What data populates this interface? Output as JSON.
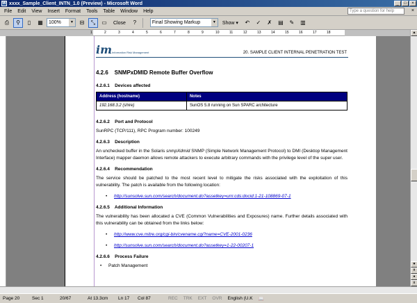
{
  "window": {
    "title": "xxxx_Sample_Client_INTN_1.0 (Preview) - Microsoft Word"
  },
  "menu": {
    "items": [
      "File",
      "Edit",
      "View",
      "Insert",
      "Format",
      "Tools",
      "Table",
      "Window",
      "Help"
    ],
    "help_placeholder": "Type a question for help"
  },
  "toolbar": {
    "zoom": "100%",
    "close_label": "Close",
    "markup_view": "Final Showing Markup",
    "show_label": "Show"
  },
  "ruler": {
    "marks": [
      "1",
      "2",
      "3",
      "4",
      "5",
      "6",
      "7",
      "8",
      "9",
      "10",
      "11",
      "12",
      "13",
      "14",
      "15",
      "16",
      "17",
      "18"
    ]
  },
  "header": {
    "logo_text": "im",
    "logo_sub": "Information Risk Management",
    "title": "20. SAMPLE CLIENT INTERNAL PENETRATION TEST"
  },
  "doc": {
    "section_heading": "4.2.6    SNMPxDMID Remote Buffer Overflow",
    "devices_heading": "4.2.6.1    Devices affected",
    "table": {
      "headers": [
        "Address (hostname)",
        "Notes"
      ],
      "rows": [
        [
          "192.168.3.2 (shire)",
          "SunOS 5.8 running on Sun SPARC architecture"
        ]
      ]
    },
    "port_heading": "4.2.6.2    Port and Protocol",
    "port_text": "SunRPC (TCP/111), RPC Program number: 100249",
    "desc_heading": "4.2.6.3    Description",
    "desc_text_1": "An unchecked buffer in the Solaris ",
    "desc_text_italic": "snmpXdmid",
    "desc_text_2": " SNMP (Simple Network Management Protocol) to DMI (Desktop Management Interface) mapper daemon allows remote attackers to execute arbitrary commands with the privilege level of the super user.",
    "rec_heading": "4.2.6.4    Recommendation",
    "rec_text": "The service should be patched to the most recent level to mitigate the risks associated with the exploitation of this vulnerability. The patch is available from the following location:",
    "rec_link": "http://sunsolve.sun.com/search/document.do?assetkey=urn:cds:docid:1-21-108869-07-1",
    "info_heading": "4.2.6.5    Additional Information",
    "info_text": "The vulnerability has been allocated a CVE (Common Vulnerabilities and Exposures) name. Further details associated with this vulnerability can be obtained from the links below:",
    "info_link_1": "http://www.cve.mitre.org/cgi-bin/cvename.cgi?name=CVE-2001-0236",
    "info_link_2": "http://sunsolve.sun.com/search/document.do?assetkey=1-22-00207-1",
    "failure_heading": "4.2.6.6    Process Failure",
    "failure_bullet": "Patch Management"
  },
  "status": {
    "page": "Page 20",
    "sec": "Sec 1",
    "pages": "20/67",
    "at": "At 13.3cm",
    "ln": "Ln 17",
    "col": "Col 87",
    "rec": "REC",
    "trk": "TRK",
    "ext": "EXT",
    "ovr": "OVR",
    "lang": "English (U.K"
  }
}
